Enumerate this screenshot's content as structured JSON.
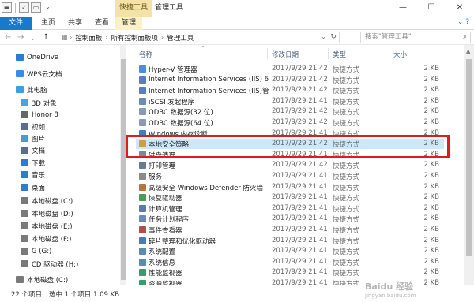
{
  "titlebar": {
    "context_tab": "快捷工具",
    "window_title": "管理工具",
    "minimize": "—",
    "maximize": "☐",
    "close": "✕"
  },
  "ribbon": {
    "tabs": [
      "文件",
      "主页",
      "共享",
      "查看",
      "管理"
    ]
  },
  "address": {
    "back": "←",
    "forward": "→",
    "up": "↑",
    "recent": "⌄",
    "path": [
      "控制面板",
      "所有控制面板项",
      "管理工具"
    ],
    "search_placeholder": "搜索\"管理工具\""
  },
  "sidebar": {
    "items": [
      {
        "label": "OneDrive",
        "icon": "cloud-icon",
        "color": "#2b7cd3"
      },
      {
        "label": "WPS云文档",
        "icon": "cloud-doc-icon",
        "color": "#3a8be8"
      },
      {
        "label": "此电脑",
        "icon": "computer-icon",
        "color": "#3b9fe0"
      },
      {
        "label": "3D 对象",
        "icon": "cube-icon",
        "color": "#4aa3df"
      },
      {
        "label": "Honor 8",
        "icon": "phone-icon",
        "color": "#666666"
      },
      {
        "label": "视频",
        "icon": "video-icon",
        "color": "#5b6e8c"
      },
      {
        "label": "图片",
        "icon": "picture-icon",
        "color": "#4a9ad6"
      },
      {
        "label": "文档",
        "icon": "document-icon",
        "color": "#5b6e8c"
      },
      {
        "label": "下载",
        "icon": "download-icon",
        "color": "#2b7cd3"
      },
      {
        "label": "音乐",
        "icon": "music-icon",
        "color": "#2b7cd3"
      },
      {
        "label": "桌面",
        "icon": "desktop-icon",
        "color": "#2b7cd3"
      },
      {
        "label": "本地磁盘 (C:)",
        "icon": "drive-icon",
        "color": "#7a7a7a"
      },
      {
        "label": "本地磁盘 (D:)",
        "icon": "drive-icon",
        "color": "#7a7a7a"
      },
      {
        "label": "本地磁盘 (E:)",
        "icon": "drive-icon",
        "color": "#7a7a7a"
      },
      {
        "label": "本地磁盘 (F:)",
        "icon": "drive-icon",
        "color": "#7a7a7a"
      },
      {
        "label": "G (G:)",
        "icon": "drive-icon",
        "color": "#7a7a7a"
      },
      {
        "label": "CD 驱动器 (H:)",
        "icon": "cd-drive-icon",
        "color": "#7a7a7a"
      },
      {
        "label": "本地磁盘 (C:)",
        "icon": "drive-icon",
        "color": "#7a7a7a"
      }
    ]
  },
  "columns": {
    "name": "名称",
    "date": "修改日期",
    "type": "类型",
    "size": "大小"
  },
  "files": [
    {
      "name": "Hyper-V 管理器",
      "date": "2017/9/29 21:42",
      "type": "快捷方式",
      "size": "2 KB",
      "color": "#4a8fd8"
    },
    {
      "name": "Internet Information Services (IIS) 6.0...",
      "date": "2017/9/29 21:42",
      "type": "快捷方式",
      "size": "2 KB",
      "color": "#5a7fb8"
    },
    {
      "name": "Internet Information Services (IIS)管...",
      "date": "2017/9/29 21:42",
      "type": "快捷方式",
      "size": "2 KB",
      "color": "#5a7fb8"
    },
    {
      "name": "iSCSI 发起程序",
      "date": "2017/9/29 21:41",
      "type": "快捷方式",
      "size": "2 KB",
      "color": "#6a8ab8"
    },
    {
      "name": "ODBC 数据源(32 位)",
      "date": "2017/9/29 21:42",
      "type": "快捷方式",
      "size": "2 KB",
      "color": "#8a9ab0"
    },
    {
      "name": "ODBC 数据源(64 位)",
      "date": "2017/9/29 21:42",
      "type": "快捷方式",
      "size": "2 KB",
      "color": "#8a9ab0"
    },
    {
      "name": "Windows 内存诊断",
      "date": "2017/9/29 21:41",
      "type": "快捷方式",
      "size": "2 KB",
      "color": "#3d7ec6"
    },
    {
      "name": "本地安全策略",
      "date": "2017/9/29 21:42",
      "type": "快捷方式",
      "size": "2 KB",
      "color": "#c9a23a"
    },
    {
      "name": "磁盘清理",
      "date": "2017/9/29 21:41",
      "type": "快捷方式",
      "size": "2 KB",
      "color": "#7a8a9a"
    },
    {
      "name": "打印管理",
      "date": "2017/9/29 21:42",
      "type": "快捷方式",
      "size": "2 KB",
      "color": "#6a7a8a"
    },
    {
      "name": "服务",
      "date": "2017/9/29 21:41",
      "type": "快捷方式",
      "size": "2 KB",
      "color": "#8a8a8a"
    },
    {
      "name": "高级安全 Windows Defender 防火墙",
      "date": "2017/9/29 21:41",
      "type": "快捷方式",
      "size": "2 KB",
      "color": "#b8743a"
    },
    {
      "name": "恢复驱动器",
      "date": "2017/9/29 21:41",
      "type": "快捷方式",
      "size": "2 KB",
      "color": "#4a9a5a"
    },
    {
      "name": "计算机管理",
      "date": "2017/9/29 21:41",
      "type": "快捷方式",
      "size": "2 KB",
      "color": "#5a7aa8"
    },
    {
      "name": "任务计划程序",
      "date": "2017/9/29 21:41",
      "type": "快捷方式",
      "size": "2 KB",
      "color": "#6a8ab8"
    },
    {
      "name": "事件查看器",
      "date": "2017/9/29 21:41",
      "type": "快捷方式",
      "size": "2 KB",
      "color": "#b84a4a"
    },
    {
      "name": "碎片整理和优化驱动器",
      "date": "2017/9/29 21:41",
      "type": "快捷方式",
      "size": "2 KB",
      "color": "#4a7ab8"
    },
    {
      "name": "系统配置",
      "date": "2017/9/29 21:41",
      "type": "快捷方式",
      "size": "2 KB",
      "color": "#5a8ab0"
    },
    {
      "name": "系统信息",
      "date": "2017/9/29 21:41",
      "type": "快捷方式",
      "size": "2 KB",
      "color": "#5a8ab0"
    },
    {
      "name": "性能监视器",
      "date": "2017/9/29 21:41",
      "type": "快捷方式",
      "size": "2 KB",
      "color": "#3a9a6a"
    },
    {
      "name": "资源监视器",
      "date": "2017/9/29 21:41",
      "type": "快捷方式",
      "size": "2 KB",
      "color": "#3a9a6a"
    }
  ],
  "selected_index": 7,
  "status": {
    "count": "22 个项目",
    "selection": "选中 1 个项目  1.09 KB"
  },
  "watermark": {
    "line1": "Baidu 经验",
    "line2": "jingyan.baidu.com"
  }
}
